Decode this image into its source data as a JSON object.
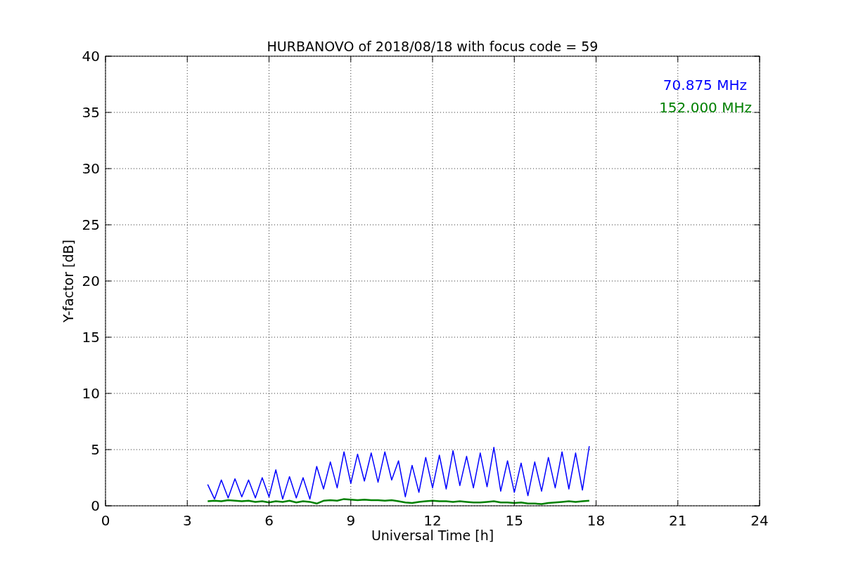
{
  "figure": {
    "chart_data": {
      "type": "line",
      "title": "HURBANOVO of 2018/08/18 with focus code = 59",
      "xlabel": "Universal Time [h]",
      "ylabel": "Y-factor [dB]",
      "x": [
        3.75,
        4.0,
        4.25,
        4.5,
        4.75,
        5.0,
        5.25,
        5.5,
        5.75,
        6.0,
        6.25,
        6.5,
        6.75,
        7.0,
        7.25,
        7.5,
        7.75,
        8.0,
        8.25,
        8.5,
        8.75,
        9.0,
        9.25,
        9.5,
        9.75,
        10.0,
        10.25,
        10.5,
        10.75,
        11.0,
        11.25,
        11.5,
        11.75,
        12.0,
        12.25,
        12.5,
        12.75,
        13.0,
        13.25,
        13.5,
        13.75,
        14.0,
        14.25,
        14.5,
        14.75,
        15.0,
        15.25,
        15.5,
        15.75,
        16.0,
        16.25,
        16.5,
        16.75,
        17.0,
        17.25,
        17.5,
        17.75
      ],
      "series": [
        {
          "name": "70.875 MHz",
          "color": "#0000ff",
          "values": [
            1.9,
            0.6,
            2.3,
            0.7,
            2.4,
            0.8,
            2.3,
            0.7,
            2.5,
            0.8,
            3.2,
            0.6,
            2.6,
            0.7,
            2.5,
            0.6,
            3.5,
            1.5,
            3.9,
            1.6,
            4.8,
            2.0,
            4.6,
            2.2,
            4.7,
            2.1,
            4.8,
            2.3,
            4.0,
            0.8,
            3.6,
            1.2,
            4.3,
            1.6,
            4.5,
            1.5,
            4.9,
            1.8,
            4.4,
            1.6,
            4.7,
            1.7,
            5.2,
            1.3,
            4.0,
            1.2,
            3.8,
            0.9,
            3.9,
            1.3,
            4.3,
            1.6,
            4.8,
            1.5,
            4.7,
            1.4,
            5.3
          ]
        },
        {
          "name": "152.000 MHz",
          "color": "#008000",
          "values": [
            0.4,
            0.45,
            0.4,
            0.5,
            0.45,
            0.4,
            0.45,
            0.35,
            0.4,
            0.3,
            0.4,
            0.35,
            0.45,
            0.3,
            0.4,
            0.35,
            0.2,
            0.45,
            0.5,
            0.45,
            0.6,
            0.55,
            0.5,
            0.55,
            0.5,
            0.5,
            0.45,
            0.5,
            0.4,
            0.3,
            0.25,
            0.35,
            0.4,
            0.45,
            0.4,
            0.4,
            0.35,
            0.4,
            0.35,
            0.3,
            0.3,
            0.35,
            0.4,
            0.3,
            0.3,
            0.25,
            0.3,
            0.2,
            0.2,
            0.15,
            0.25,
            0.3,
            0.35,
            0.4,
            0.35,
            0.4,
            0.45
          ]
        }
      ],
      "grid": true,
      "xlim": [
        0,
        24
      ],
      "ylim": [
        0,
        40
      ],
      "xticks": [
        0,
        3,
        6,
        9,
        12,
        15,
        18,
        21,
        24
      ],
      "yticks": [
        0,
        5,
        10,
        15,
        20,
        25,
        30,
        35,
        40
      ]
    }
  }
}
